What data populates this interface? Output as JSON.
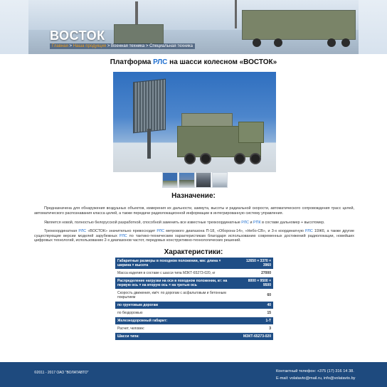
{
  "header": {
    "brand": "ВОСТОК",
    "breadcrumbs": [
      {
        "label": "Главная",
        "active": true
      },
      {
        "label": "Наша продукция",
        "active": true
      },
      {
        "label": "Военная техника",
        "active": false
      },
      {
        "label": "Специальная техника",
        "active": false
      }
    ],
    "separator": ">"
  },
  "page": {
    "title_prefix": "Платформа",
    "title_hl": "РЛС",
    "title_suffix": "на шасси колесном «ВОСТОК»",
    "thumbnails": [
      "radar-front-view",
      "radar-side-view",
      "radar-cab-view",
      "radar-detail-view"
    ]
  },
  "purpose": {
    "heading": "Назначение:",
    "p1": "Предназначена для обнаружения воздушных объектов, измерения их дальности, азимута, высоты и радиальной скорости, автоматического сопровождения трасс целей, автоматического распознавания класса целей, а также передачи радиолокационной информации в интегрированную систему управления.",
    "p2_a": "Является новой, полностью белорусской разработкой, способной заменить все известные трехкоординатные",
    "p2_hl1": "РЛС",
    "p2_b": "и",
    "p2_hl2": "РПК",
    "p2_c": "в составе дальномер + высотомер.",
    "p3_a": "Трехкоординатная",
    "p3_hl1": "РЛС",
    "p3_b": "«ВОСТОК» значительно превосходит",
    "p3_hl2": "РЛС",
    "p3_c": "метрового диапазона П-18, «Оборона-14», «Небо-СВ», и 3-х координатную",
    "p3_hl3": "РЛС",
    "p3_d": "19Ж6, а также другие существующие версии моделей зарубежных",
    "p3_hl4": "РЛС",
    "p3_e": "по тактико-техническим характеристикам благодаря использованию современных достижений радиолокации, новейших цифровых технологий, использованию 2-х диапазонов частот, передовых конструктивно-технологических решений."
  },
  "specs": {
    "heading": "Характеристики:",
    "rows": [
      {
        "label": "Габаритные размеры в походном положении, мм: длина × ширина × высота",
        "value": "12650 × 3370 × 3960",
        "style": "dark"
      },
      {
        "label": "Масса изделия в составе с шасси типа МЗКТ-65273-020, кг",
        "value": "27000",
        "style": "light"
      },
      {
        "label": "Распределение нагрузки на оси в походном положении, кг: на первую ось × на вторую ось × на третью ось",
        "value": "8000 × 9500 × 9500",
        "style": "dark"
      },
      {
        "label": "Скорость движения, км/ч: по дорогам с асфальтовым и бетонным покрытием",
        "value": "60",
        "style": "light"
      },
      {
        "label": "по грунтовым дорогам",
        "value": "40",
        "style": "dark"
      },
      {
        "label": "по бездорожью",
        "value": "15",
        "style": "light"
      },
      {
        "label": "Железнодорожный габарит:",
        "value": "1-Т",
        "style": "dark"
      },
      {
        "label": "Расчет, человек:",
        "value": "3",
        "style": "light"
      },
      {
        "label": "Шасси типа:",
        "value": "МЗКТ-65273-020",
        "style": "dark"
      }
    ]
  },
  "footer": {
    "copyright": "©2011 - 2017 ОАО \"ВОЛАТАВТО\"",
    "phone_label": "Контактный телефон:",
    "phone": "+375 (17) 316 14 38.",
    "email_label": "E-mail:",
    "emails": "volatavto@mail.ru, info@volatavto.by"
  },
  "colors": {
    "accent": "#1f6fd0",
    "table_dark": "#1f4e86",
    "footer": "#1e4a7e",
    "breadcrumb_active": "#f0a020"
  }
}
